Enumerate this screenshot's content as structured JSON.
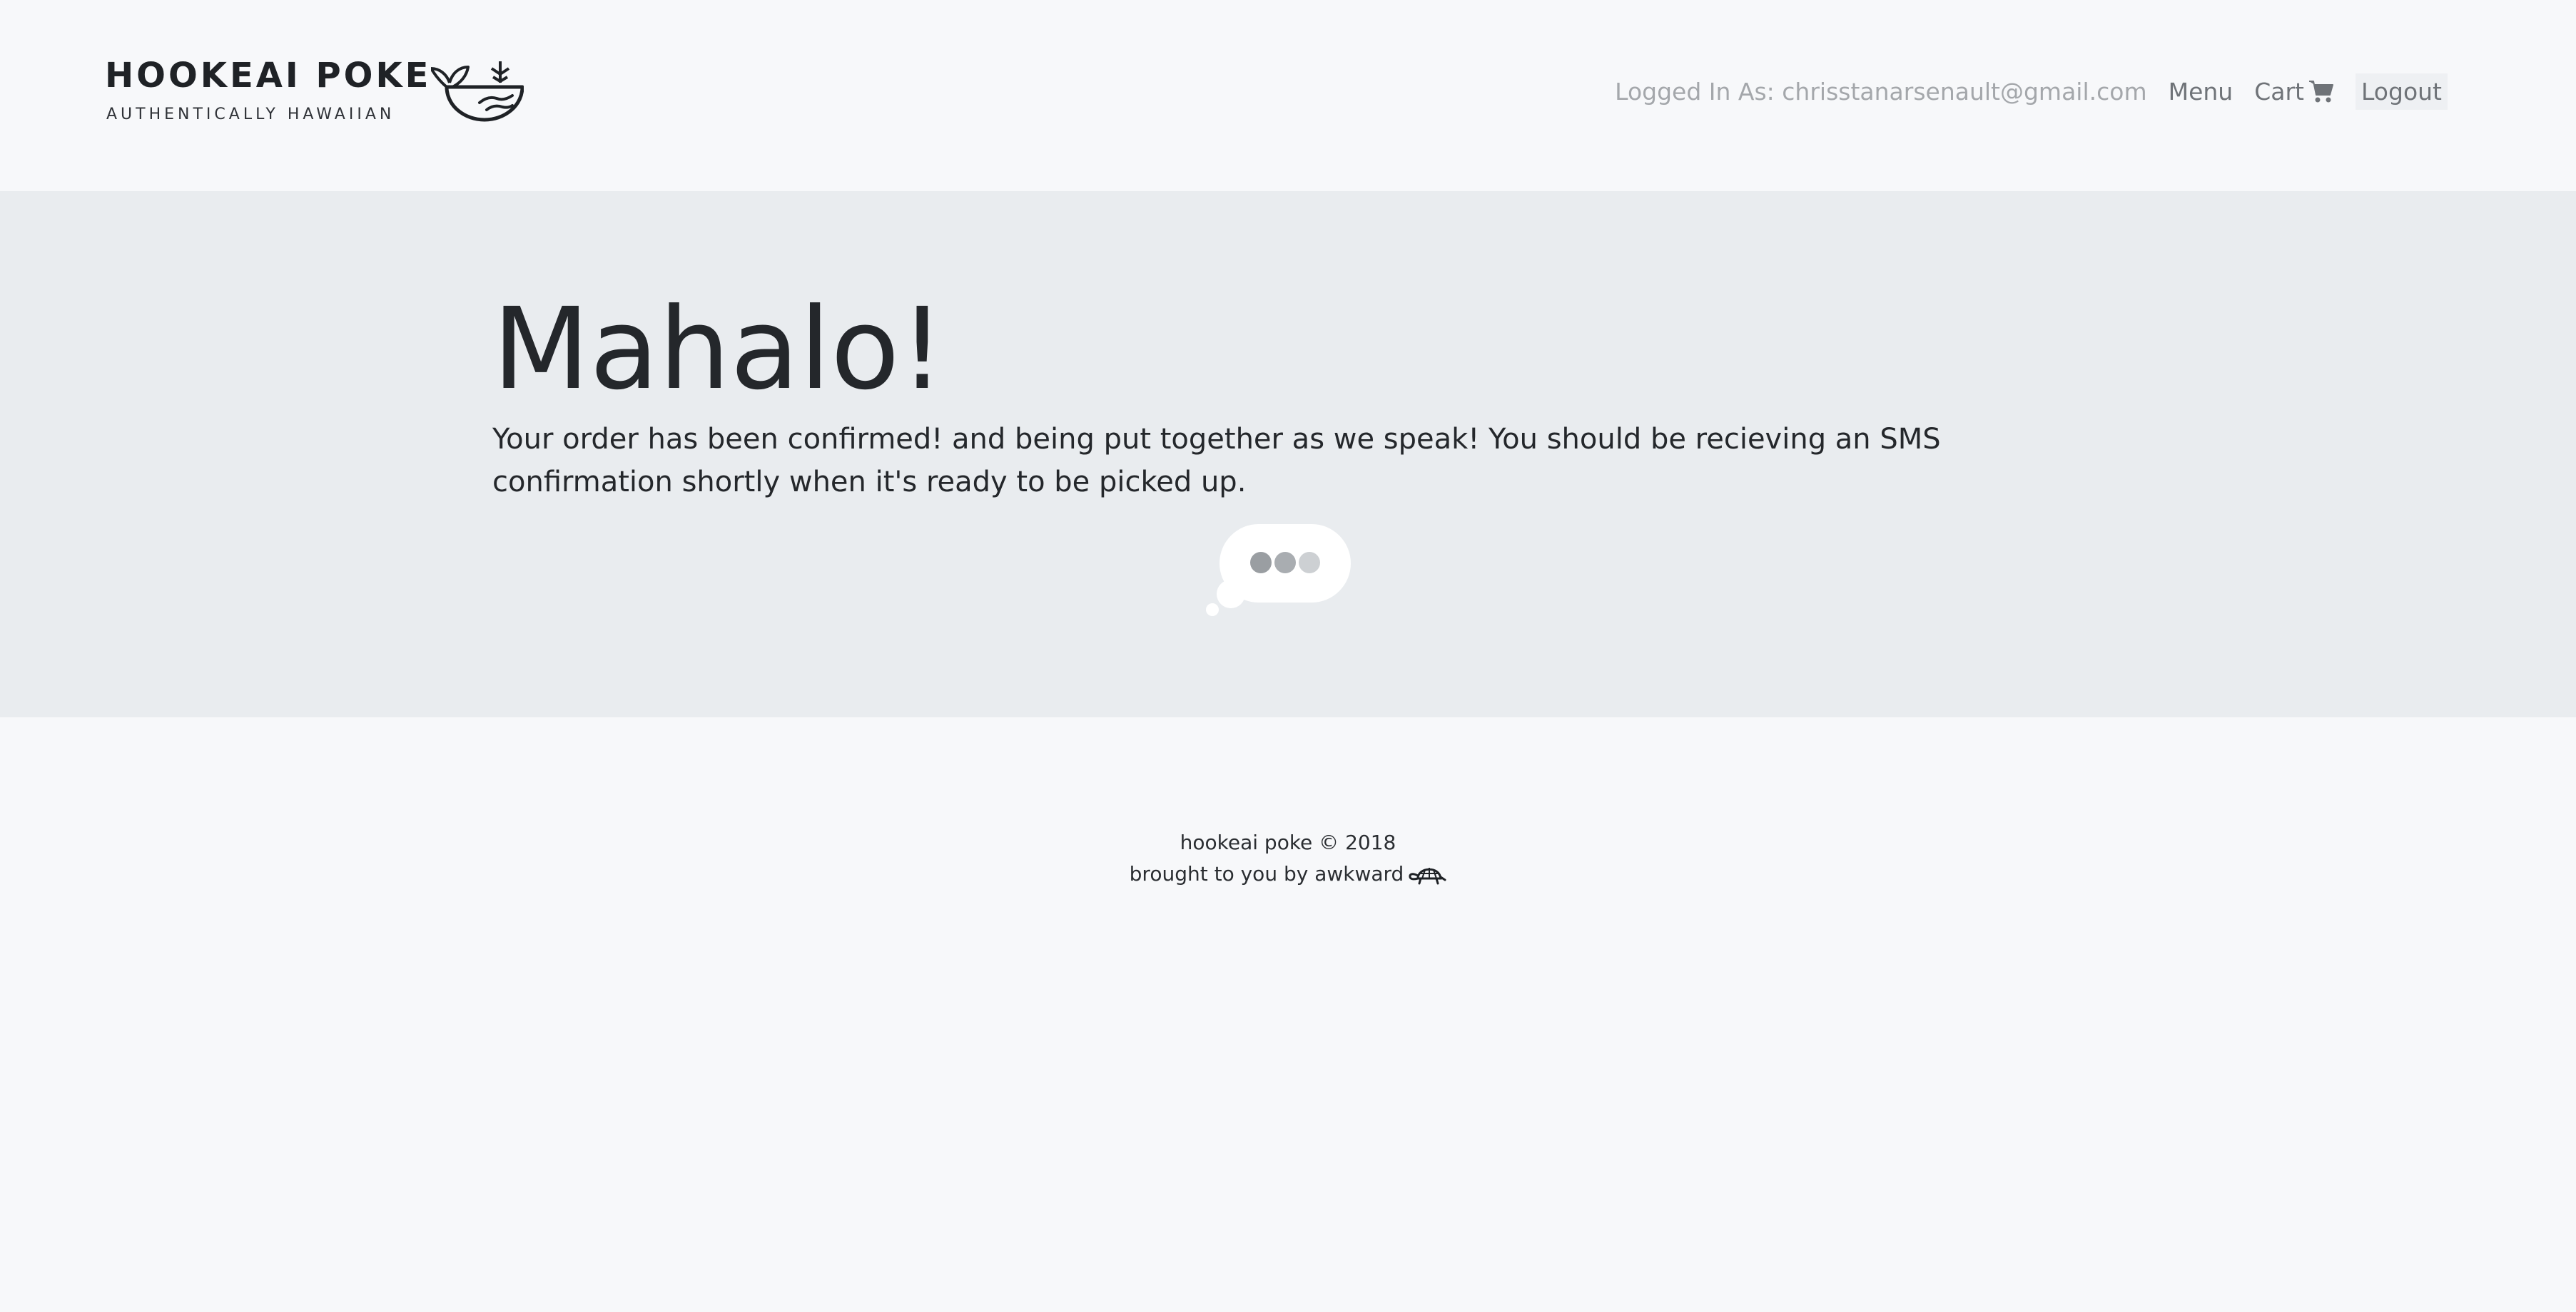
{
  "brand": {
    "title": "HOOKEAI POKE",
    "tagline": "AUTHENTICALLY HAWAIIAN",
    "logo_icon": "whale-bowl-logo-icon"
  },
  "nav": {
    "logged_in_label": "Logged In As: chrisstanarsenault@gmail.com",
    "menu_label": "Menu",
    "cart_label": "Cart",
    "cart_icon": "shopping-cart-icon",
    "logout_label": "Logout"
  },
  "confirmation": {
    "heading": "Mahalo!",
    "message": "Your order has been confirmed! and being put together as we speak! You should be recieving an SMS confirmation shortly when it's ready to be picked up.",
    "loader_icon": "thought-bubble-loading-icon"
  },
  "footer": {
    "copyright": "hookeai poke © 2018",
    "credit": "brought to you by awkward",
    "credit_icon": "turtle-icon"
  },
  "colors": {
    "page_background": "#f7f8fa",
    "banner_background": "#e9ecef",
    "text_dark": "#24272b",
    "nav_text": "#6f7378",
    "nav_muted": "#a4a7ab"
  }
}
